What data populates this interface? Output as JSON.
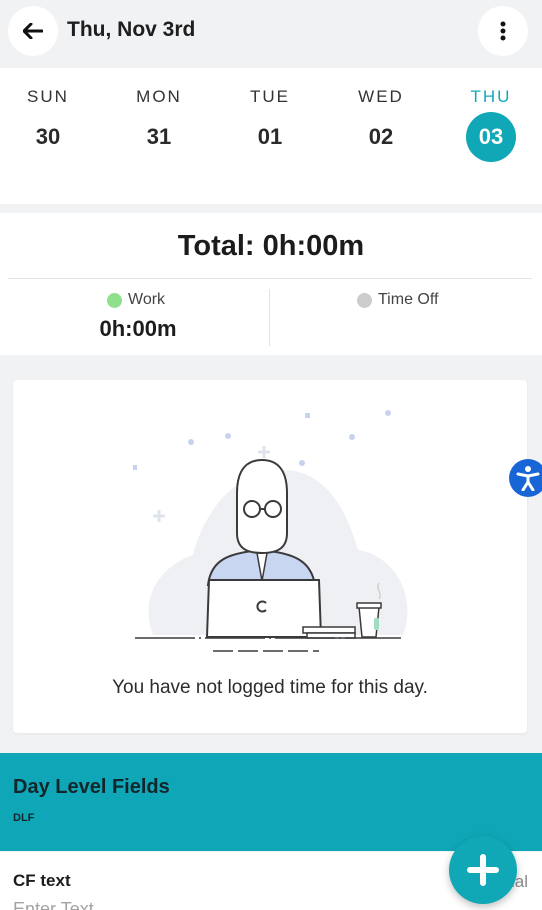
{
  "header": {
    "title": "Thu, Nov 3rd",
    "back_icon": "arrow-left-icon",
    "more_icon": "more-vertical-icon"
  },
  "week": {
    "days": [
      {
        "name": "SUN",
        "num": "30",
        "active": false
      },
      {
        "name": "MON",
        "num": "31",
        "active": false
      },
      {
        "name": "TUE",
        "num": "01",
        "active": false
      },
      {
        "name": "WED",
        "num": "02",
        "active": false
      },
      {
        "name": "THU",
        "num": "03",
        "active": true
      }
    ],
    "accent_color": "#10a7b6"
  },
  "totals": {
    "total_label": "Total: 0h:00m",
    "work_label": "Work",
    "work_hours": "0h:00m",
    "work_color": "#8ee08a",
    "timeoff_label": "Time Off",
    "timeoff_color": "#cccccc"
  },
  "empty_state": {
    "message": "You have not logged time for this day.",
    "illustration": "person-at-laptop-illustration"
  },
  "accessibility": {
    "icon": "accessibility-icon",
    "color": "#1866d6"
  },
  "day_level_fields": {
    "title": "Day Level Fields",
    "subtitle": "DLF",
    "background": "#0fa7b7"
  },
  "cf_text": {
    "label": "CF text",
    "optional_label": "Optional",
    "placeholder": "Enter Text",
    "value": ""
  },
  "fab": {
    "icon": "plus-icon"
  }
}
